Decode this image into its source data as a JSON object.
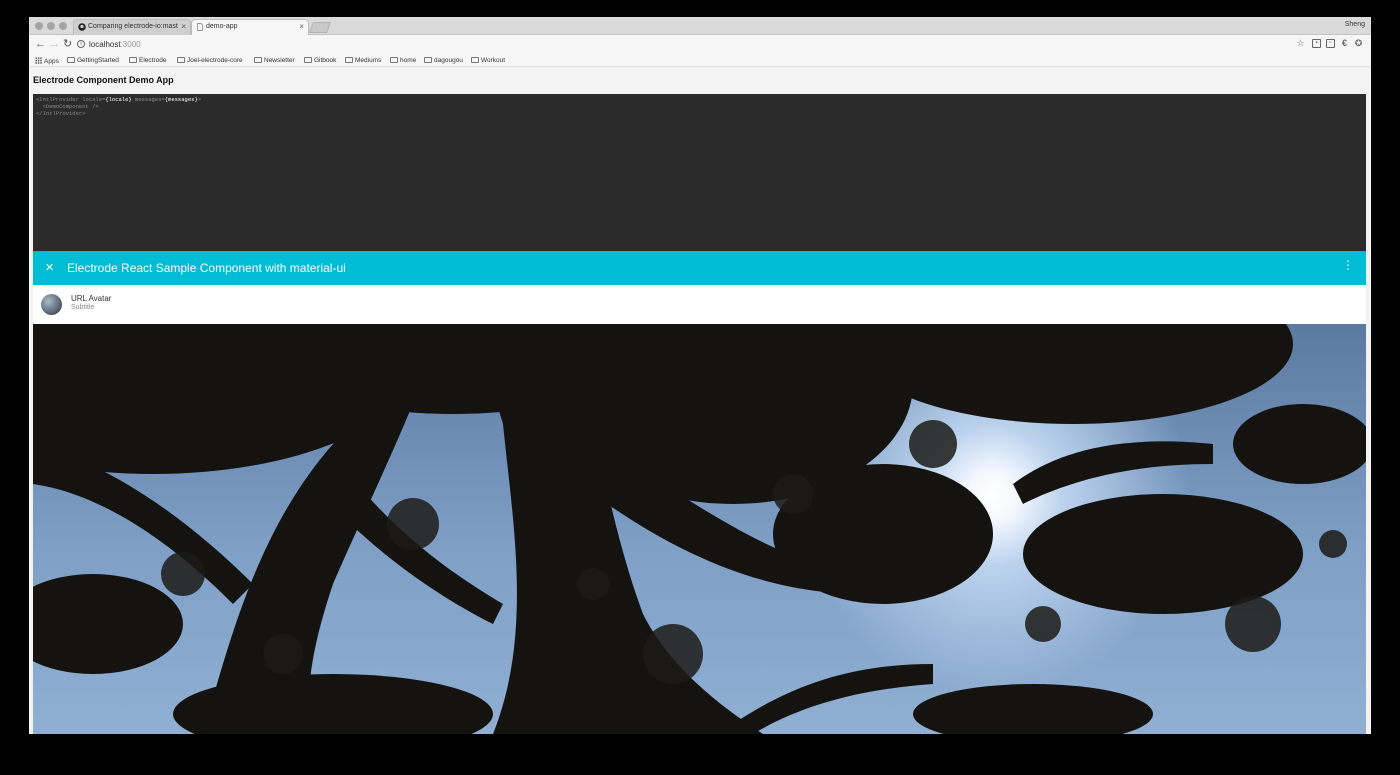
{
  "browser": {
    "tabs": [
      {
        "label": "Comparing electrode-io:mast",
        "icon": "github-icon"
      },
      {
        "label": "demo-app",
        "icon": "page-icon"
      }
    ],
    "profile_name": "Sheng",
    "url_host": "localhost",
    "url_port": ":3000",
    "bookmarks": [
      {
        "label": "Apps",
        "icon": "apps-grid-icon"
      },
      {
        "label": "GettingStarted",
        "icon": "folder-icon"
      },
      {
        "label": "Electrode",
        "icon": "folder-icon"
      },
      {
        "label": "Joel-electrode-core",
        "icon": "folder-icon"
      },
      {
        "label": "Newsletter",
        "icon": "folder-icon"
      },
      {
        "label": "Gitbook",
        "icon": "folder-icon"
      },
      {
        "label": "Mediums",
        "icon": "folder-icon"
      },
      {
        "label": "home",
        "icon": "folder-icon"
      },
      {
        "label": "dagougou",
        "icon": "folder-icon"
      },
      {
        "label": "Workout",
        "icon": "folder-icon"
      }
    ]
  },
  "page": {
    "title": "Electrode Component Demo App",
    "code": {
      "line1_open": "<IntlProvider locale=",
      "line1_locale": "{locale}",
      "line1_mid": " messages=",
      "line1_messages": "{messages}",
      "line1_close": ">",
      "line2": "  <DemoComponent />",
      "line3": "</IntlProvider>"
    },
    "appbar": {
      "title": "Electrode React Sample Component with material-ui",
      "accent_color": "#00bcd4"
    },
    "card": {
      "title": "URL Avatar",
      "subtitle": "Subtitle"
    }
  }
}
